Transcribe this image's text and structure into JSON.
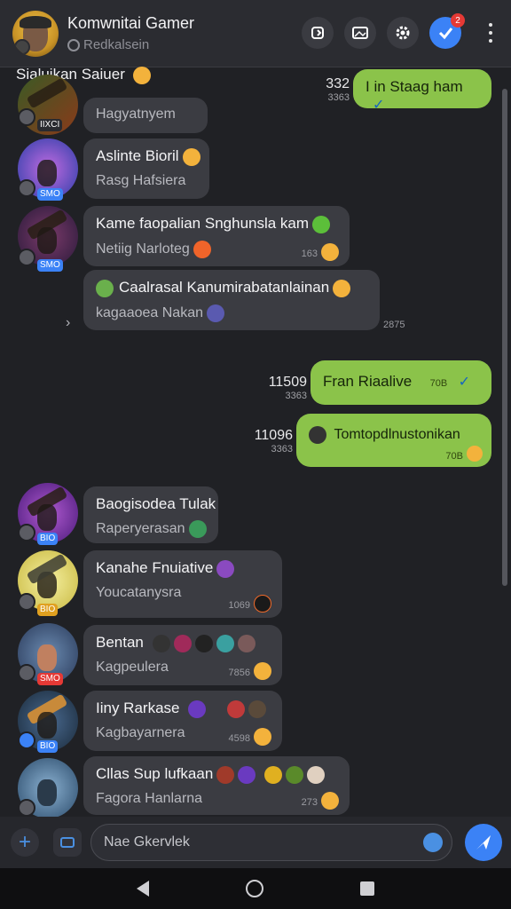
{
  "header": {
    "title": "Komwnitai Gamer",
    "subtitle": "Redkalsein",
    "notification_count": "2"
  },
  "pinned_text": "Sialuikan Saiuer",
  "incoming": [
    {
      "title": "",
      "text": "Hagyatnyem",
      "level": "IIXCI",
      "time": ""
    },
    {
      "title": "Aslinte Bioril",
      "text": "Rasg Hafsiera",
      "level": "SMO",
      "time": ""
    },
    {
      "title": "Kame faopalian Snghunsla kam",
      "text": "Netiig Narloteg",
      "level": "SMO",
      "time": "163"
    },
    {
      "title": "Caalrasal Kanumirabatanlainan",
      "text": "kagaaoea Nakan",
      "level": "",
      "time": "2875"
    },
    {
      "title": "Baogisodea Tulak",
      "text": "Raperyerasan",
      "level": "BIO",
      "time": ""
    },
    {
      "title": "Kanahe Fnuiative",
      "text": "Youcatanysra",
      "level": "BIO",
      "time": "1069"
    },
    {
      "title": "Bentan",
      "text": "Kagpeulera",
      "level": "SMO",
      "time": "7856"
    },
    {
      "title": "Iiny Rarkase",
      "text": "Kagbayarnera",
      "level": "BIO",
      "time": "4598"
    },
    {
      "title": "Cllas Sup lufkaan",
      "text": "Fagora Hanlarna",
      "level": "",
      "time": "273"
    }
  ],
  "outgoing": [
    {
      "text": "I in Staag ham",
      "time": "",
      "side_big": "332",
      "side_small": "3363"
    },
    {
      "text": "Fran Riaalive",
      "time": "70B",
      "side_big": "11509",
      "side_small": "3363"
    },
    {
      "text": "Tomtopdlnustonikan",
      "time": "70B",
      "side_big": "11096",
      "side_small": "3363"
    }
  ],
  "composer": {
    "placeholder": "Nae Gkervlek"
  },
  "colors": {
    "accent": "#3b82f6",
    "outgoing_bubble": "#8bc34a",
    "incoming_bubble": "#3b3c42",
    "background": "#202125"
  }
}
